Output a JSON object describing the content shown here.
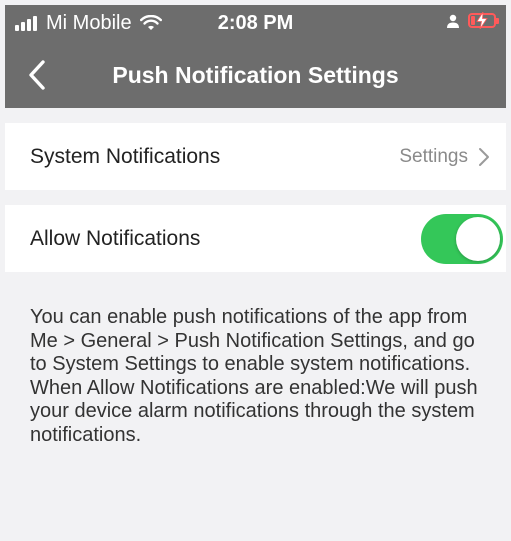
{
  "status_bar": {
    "carrier": "Mi Mobile",
    "time": "2:08 PM",
    "battery_level": 0.2,
    "battery_color": "#ff5a5a"
  },
  "nav": {
    "back_icon": "chevron-left-icon",
    "title": "Push Notification Settings"
  },
  "rows": {
    "system_notifications": {
      "label": "System Notifications",
      "action": "Settings",
      "icon": "chevron-right-icon"
    },
    "allow_notifications": {
      "label": "Allow Notifications",
      "enabled": true,
      "toggle_color": "#34c759"
    }
  },
  "description": {
    "paragraph1": "You can enable push notifications of the app from Me > General > Push Notification Settings, and go to System Settings to enable system notifications.",
    "paragraph2": "When Allow Notifications are enabled:We will push your device alarm notifications through the system notifications."
  }
}
